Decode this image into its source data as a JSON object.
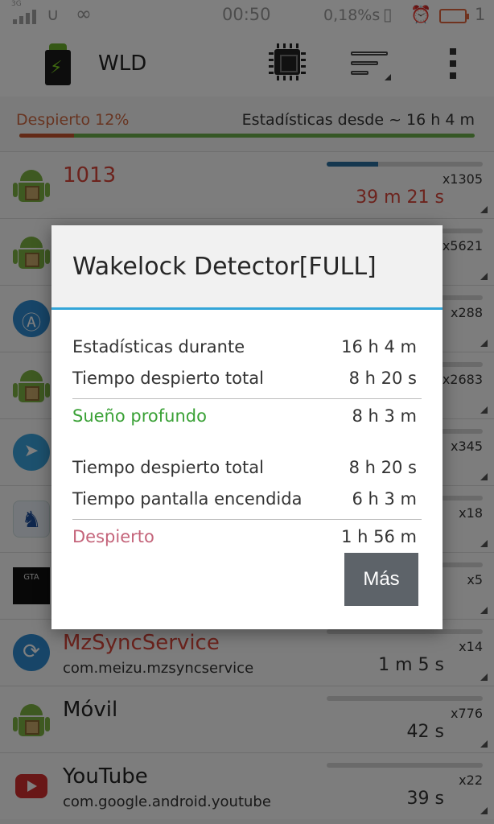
{
  "status_bar": {
    "network": "3G",
    "time": "00:50",
    "speed": "0,18%s",
    "notification_count": "1"
  },
  "app_bar": {
    "title": "WLD",
    "icons": [
      "battery-logo-icon",
      "cpu-icon",
      "sort-icon",
      "more-menu-icon"
    ]
  },
  "summary": {
    "awake_label": "Despierto 12%",
    "since_label": "Estadísticas desde ~ 16 h 4 m",
    "awake_fraction": 0.12
  },
  "list": [
    {
      "name": "1013",
      "package": "",
      "count": "x1305",
      "duration": "39 m 21 s",
      "highlight": true,
      "icon": "android-icon",
      "bar": 0.33
    },
    {
      "name": "",
      "package": "",
      "count": "x5621",
      "duration": "",
      "highlight": false,
      "icon": "android-icon",
      "bar": 0
    },
    {
      "name": "",
      "package": "",
      "count": "x288",
      "duration": "",
      "highlight": false,
      "icon": "aida-icon",
      "bar": 0
    },
    {
      "name": "",
      "package": "",
      "count": "x2683",
      "duration": "",
      "highlight": false,
      "icon": "android-icon",
      "bar": 0
    },
    {
      "name": "",
      "package": "",
      "count": "x345",
      "duration": "",
      "highlight": false,
      "icon": "telegram-icon",
      "bar": 0
    },
    {
      "name": "",
      "package": "",
      "count": "x18",
      "duration": "",
      "highlight": false,
      "icon": "chess-knight-icon",
      "bar": 0
    },
    {
      "name": "",
      "package": "",
      "count": "x5",
      "duration": "",
      "highlight": false,
      "icon": "gta-icon",
      "bar": 0
    },
    {
      "name": "MzSyncService",
      "package": "com.meizu.mzsyncservice",
      "count": "x14",
      "duration": "1 m 5 s",
      "highlight": true,
      "icon": "sync-icon",
      "bar": 0
    },
    {
      "name": "Móvil",
      "package": "",
      "count": "x776",
      "duration": "42 s",
      "highlight": false,
      "icon": "android-icon",
      "bar": 0
    },
    {
      "name": "YouTube",
      "package": "com.google.android.youtube",
      "count": "x22",
      "duration": "39 s",
      "highlight": false,
      "icon": "youtube-icon",
      "bar": 0
    }
  ],
  "dialog": {
    "title": "Wakelock Detector[FULL]",
    "stats_during_label": "Estadísticas durante",
    "stats_during_value": "16 h 4 m",
    "awake_total_label": "Tiempo despierto total",
    "awake_total_value": "8 h 20 s",
    "deep_sleep_label": "Sueño profundo",
    "deep_sleep_value": "8 h 3 m",
    "awake_total_label_2": "Tiempo despierto total",
    "awake_total_value_2": "8 h 20 s",
    "screen_on_label": "Tiempo pantalla encendida",
    "screen_on_value": "6 h 3 m",
    "awake_label": "Despierto",
    "awake_value": "1 h 56 m",
    "more_button": "Más"
  },
  "colors": {
    "accent": "#33a5d8",
    "deep_sleep": "#3aa136",
    "awake": "#c4647a",
    "highlight_red": "#d9463b"
  }
}
